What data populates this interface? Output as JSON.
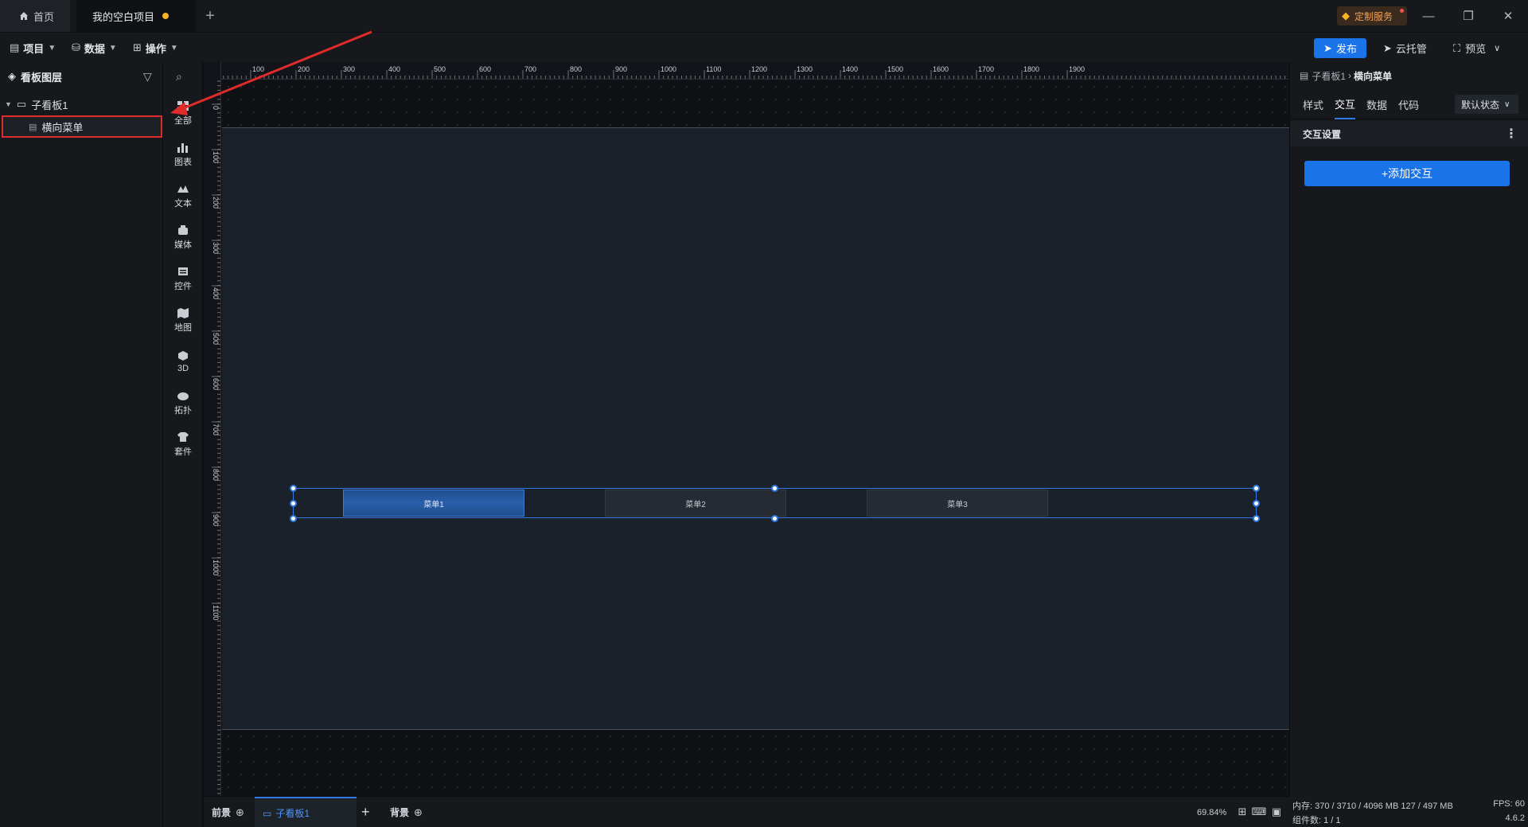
{
  "titlebar": {
    "home_tab": "首页",
    "project_tab": "我的空白项目",
    "custom_service": "定制服务",
    "win_minimize": "—",
    "win_restore": "❐",
    "win_close": "✕"
  },
  "toolbar": {
    "menus": [
      "项目",
      "数据",
      "操作"
    ],
    "publish": "发布",
    "cloud": "云托管",
    "preview": "预览"
  },
  "layers": {
    "title": "看板图层",
    "group": "子看板1",
    "item": "横向菜单"
  },
  "categories": [
    "全部",
    "图表",
    "文本",
    "媒体",
    "控件",
    "地图",
    "3D",
    "拓扑",
    "套件"
  ],
  "rulers": {
    "h_ticks": [
      "100",
      "200",
      "300",
      "400",
      "500",
      "600",
      "700",
      "800",
      "900",
      "1000",
      "1100",
      "1200",
      "1300",
      "1400",
      "1500",
      "1600",
      "1700",
      "1800",
      "1900"
    ],
    "v_ticks": [
      "0",
      "100",
      "200",
      "300",
      "400",
      "500",
      "600",
      "700",
      "800",
      "900",
      "1000",
      "1100"
    ]
  },
  "canvas": {
    "menu_items": [
      "菜单1",
      "菜单2",
      "菜单3"
    ],
    "active_index": 0
  },
  "bottombar": {
    "foreground": "前景",
    "board_tab": "子看板1",
    "background": "背景",
    "zoom": "69.84%"
  },
  "props": {
    "crumb_parent": "子看板1",
    "crumb_current": "横向菜单",
    "tabs": [
      "样式",
      "交互",
      "数据",
      "代码"
    ],
    "active_tab": "交互",
    "state": "默认状态",
    "section": "交互设置",
    "add_button": "+添加交互"
  },
  "status": {
    "memory": "内存: 370 / 3710 / 4096 MB  127 / 497 MB",
    "fps": "FPS: 60",
    "count": "组件数: 1 / 1",
    "version": "4.6.2"
  },
  "colors": {
    "accent": "#1a73e8",
    "highlight_border": "#e02b2b",
    "unsaved_dot": "#f5b428"
  }
}
